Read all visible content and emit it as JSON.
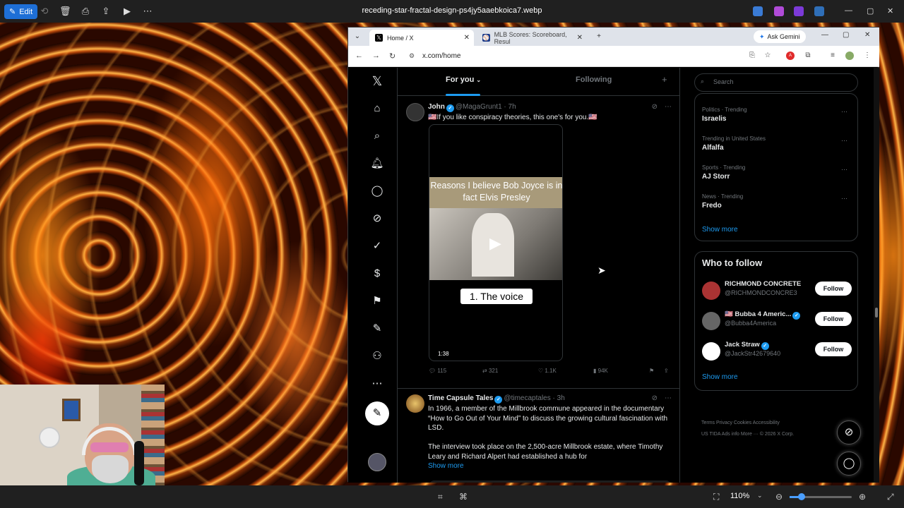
{
  "viewer": {
    "edit_label": "Edit",
    "filename": "receding-star-fractal-design-ps4jy5aaebkoica7.webp",
    "zoom": "110%"
  },
  "browser": {
    "tabs": [
      {
        "label": "Home / X"
      },
      {
        "label": "MLB Scores: Scoreboard, Resul"
      }
    ],
    "ask_gemini": "Ask Gemini",
    "url": "x.com/home"
  },
  "x": {
    "feed_tabs": {
      "for_you": "For you",
      "following": "Following"
    },
    "posts": [
      {
        "name": "John",
        "handle": "@MagaGrunt1 · 7h",
        "text": "🇺🇸If you like conspiracy theories, this one's for you.🇺🇸",
        "video": {
          "caption": "Reasons I believe Bob Joyce is in fact Elvis Presley",
          "label": "1. The voice",
          "duration": "1:38"
        },
        "stats": {
          "replies": "115",
          "reposts": "321",
          "likes": "1.1K",
          "views": "94K"
        }
      },
      {
        "name": "Time Capsule Tales",
        "handle": "@timecaptales · 3h",
        "text1": "In 1966, a member of the Millbrook commune appeared in the documentary “How to Go Out of Your Mind” to discuss the growing cultural fascination with LSD.",
        "text2": "The interview took place on the 2,500-acre Millbrook estate, where Timothy Leary and Richard Alpert had established a hub for",
        "show_more": "Show more"
      }
    ],
    "search_placeholder": "Search",
    "trends": [
      {
        "meta": "Politics · Trending",
        "title": "Israelis"
      },
      {
        "meta": "Trending in United States",
        "title": "Alfalfa"
      },
      {
        "meta": "Sports · Trending",
        "title": "AJ Storr"
      },
      {
        "meta": "News · Trending",
        "title": "Fredo"
      }
    ],
    "trends_show_more": "Show more",
    "who_to_follow": {
      "title": "Who to follow",
      "accounts": [
        {
          "name": "RICHMOND CONCRETE",
          "handle": "@RICHMONDCONCRE3",
          "button": "Follow"
        },
        {
          "name": "🇺🇸 Bubba 4 Americ...",
          "handle": "@Bubba4America",
          "button": "Follow"
        },
        {
          "name": "Jack Straw",
          "handle": "@JackStr42679640",
          "button": "Follow"
        }
      ],
      "show_more": "Show more"
    },
    "footer": {
      "line1": "Terms    Privacy    Cookies    Accessibility",
      "line2": "US TIDA    Ads info    More ···    © 2026 X Corp."
    }
  },
  "colors": {
    "accent": "#1d9bf0",
    "background": "#000000",
    "edit_button": "#1e6fd6"
  }
}
